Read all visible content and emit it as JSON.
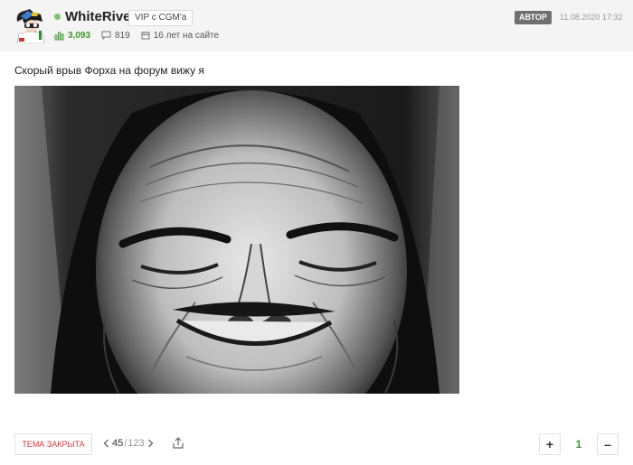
{
  "post": {
    "author": {
      "name": "WhiteRiver",
      "badge": "VIP с CGM'a",
      "rating": "3,093",
      "comments": "819",
      "tenure": "16 лет на сайте",
      "role_badge": "АВТОР",
      "online": true
    },
    "date": "11.08.2020 17:32",
    "text": "Скорый врыв Форха на форум вижу я",
    "image_alt": "черно-белый портрет пожилой женщины в платке"
  },
  "footer": {
    "closed_label": "ТЕМА ЗАКРЫТА",
    "page_current": "45",
    "page_separator": "/",
    "page_total": "123",
    "vote_plus": "+",
    "vote_count": "1",
    "vote_minus": "–"
  },
  "colors": {
    "rating": "#3e9a2e",
    "closed": "#d93b3b",
    "online": "#7cc46b",
    "author_badge": "#6f6f6f"
  }
}
